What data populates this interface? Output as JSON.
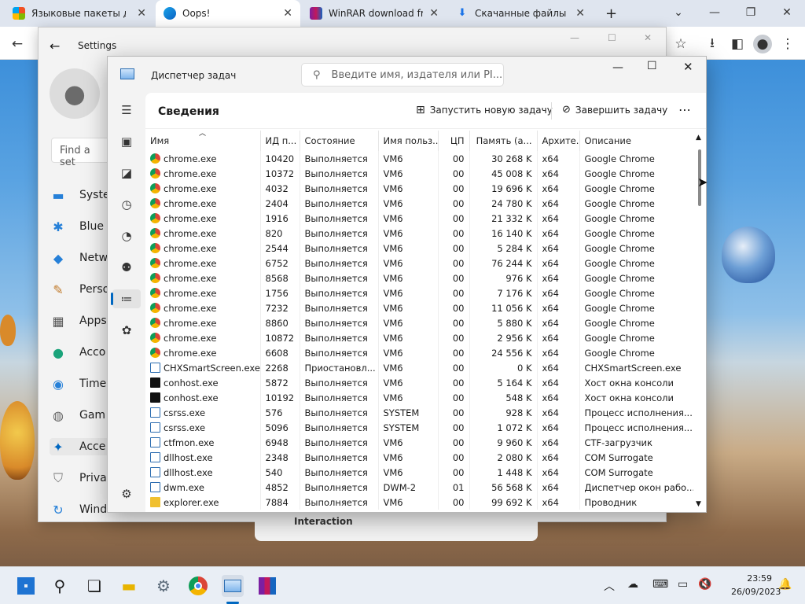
{
  "browser": {
    "tabs": [
      {
        "label": "Языковые пакеты для",
        "icon": "windows-logo-icon",
        "active": false
      },
      {
        "label": "Oops!",
        "icon": "edge-icon",
        "active": true
      },
      {
        "label": "WinRAR download free",
        "icon": "winrar-icon",
        "active": false
      },
      {
        "label": "Скачанные файлы",
        "icon": "download-icon",
        "active": false
      }
    ],
    "new_tab": "+",
    "min": "⌄",
    "max": "—",
    "restore": "❐",
    "close": "✕"
  },
  "settings": {
    "title": "Settings",
    "search_placeholder": "Find a set",
    "nav": [
      "Syste",
      "Blue",
      "Netw",
      "Perso",
      "Apps",
      "Acco",
      "Time",
      "Gam",
      "Acce",
      "Priva",
      "Wind"
    ],
    "footer_text": "Interaction"
  },
  "taskmgr": {
    "title": "Диспетчер задач",
    "search_placeholder": "Введите имя, издателя или PI...",
    "page_title": "Сведения",
    "run_task": "Запустить новую задачу",
    "end_task": "Завершить задачу",
    "more": "⋯",
    "columns": [
      "Имя",
      "ИД п...",
      "Состояние",
      "Имя польз...",
      "ЦП",
      "Память (а...",
      "Архите...",
      "Описание"
    ],
    "rows": [
      [
        "chrome.exe",
        "10420",
        "Выполняется",
        "VM6",
        "00",
        "30 268 K",
        "x64",
        "Google Chrome"
      ],
      [
        "chrome.exe",
        "10372",
        "Выполняется",
        "VM6",
        "00",
        "45 008 K",
        "x64",
        "Google Chrome"
      ],
      [
        "chrome.exe",
        "4032",
        "Выполняется",
        "VM6",
        "00",
        "19 696 K",
        "x64",
        "Google Chrome"
      ],
      [
        "chrome.exe",
        "2404",
        "Выполняется",
        "VM6",
        "00",
        "24 780 K",
        "x64",
        "Google Chrome"
      ],
      [
        "chrome.exe",
        "1916",
        "Выполняется",
        "VM6",
        "00",
        "21 332 K",
        "x64",
        "Google Chrome"
      ],
      [
        "chrome.exe",
        "820",
        "Выполняется",
        "VM6",
        "00",
        "16 140 K",
        "x64",
        "Google Chrome"
      ],
      [
        "chrome.exe",
        "2544",
        "Выполняется",
        "VM6",
        "00",
        "5 284 K",
        "x64",
        "Google Chrome"
      ],
      [
        "chrome.exe",
        "6752",
        "Выполняется",
        "VM6",
        "00",
        "76 244 K",
        "x64",
        "Google Chrome"
      ],
      [
        "chrome.exe",
        "8568",
        "Выполняется",
        "VM6",
        "00",
        "976 K",
        "x64",
        "Google Chrome"
      ],
      [
        "chrome.exe",
        "1756",
        "Выполняется",
        "VM6",
        "00",
        "7 176 K",
        "x64",
        "Google Chrome"
      ],
      [
        "chrome.exe",
        "7232",
        "Выполняется",
        "VM6",
        "00",
        "11 056 K",
        "x64",
        "Google Chrome"
      ],
      [
        "chrome.exe",
        "8860",
        "Выполняется",
        "VM6",
        "00",
        "5 880 K",
        "x64",
        "Google Chrome"
      ],
      [
        "chrome.exe",
        "10872",
        "Выполняется",
        "VM6",
        "00",
        "2 956 K",
        "x64",
        "Google Chrome"
      ],
      [
        "chrome.exe",
        "6608",
        "Выполняется",
        "VM6",
        "00",
        "24 556 K",
        "x64",
        "Google Chrome"
      ],
      [
        "CHXSmartScreen.exe",
        "2268",
        "Приостановл...",
        "VM6",
        "00",
        "0 K",
        "x64",
        "CHXSmartScreen.exe"
      ],
      [
        "conhost.exe",
        "5872",
        "Выполняется",
        "VM6",
        "00",
        "5 164 K",
        "x64",
        "Хост окна консоли"
      ],
      [
        "conhost.exe",
        "10192",
        "Выполняется",
        "VM6",
        "00",
        "548 K",
        "x64",
        "Хост окна консоли"
      ],
      [
        "csrss.exe",
        "576",
        "Выполняется",
        "SYSTEM",
        "00",
        "928 K",
        "x64",
        "Процесс исполнения..."
      ],
      [
        "csrss.exe",
        "5096",
        "Выполняется",
        "SYSTEM",
        "00",
        "1 072 K",
        "x64",
        "Процесс исполнения..."
      ],
      [
        "ctfmon.exe",
        "6948",
        "Выполняется",
        "VM6",
        "00",
        "9 960 K",
        "x64",
        "CTF-загрузчик"
      ],
      [
        "dllhost.exe",
        "2348",
        "Выполняется",
        "VM6",
        "00",
        "2 080 K",
        "x64",
        "COM Surrogate"
      ],
      [
        "dllhost.exe",
        "540",
        "Выполняется",
        "VM6",
        "00",
        "1 448 K",
        "x64",
        "COM Surrogate"
      ],
      [
        "dwm.exe",
        "4852",
        "Выполняется",
        "DWM-2",
        "01",
        "56 568 K",
        "x64",
        "Диспетчер окон рабо..."
      ],
      [
        "explorer.exe",
        "7884",
        "Выполняется",
        "VM6",
        "00",
        "99 692 K",
        "x64",
        "Проводник"
      ]
    ],
    "row_icons": [
      "chrome",
      "chrome",
      "chrome",
      "chrome",
      "chrome",
      "chrome",
      "chrome",
      "chrome",
      "chrome",
      "chrome",
      "chrome",
      "chrome",
      "chrome",
      "chrome",
      "window",
      "console",
      "console",
      "window",
      "window",
      "window",
      "window",
      "window",
      "window",
      "folder"
    ]
  },
  "taskbar": {
    "time": "23:59",
    "date": "26/09/2023"
  },
  "colors": {
    "accent": "#0067c0",
    "chrome_red": "#db4437",
    "chrome_green": "#0f9d58",
    "chrome_yellow": "#f4b400"
  }
}
